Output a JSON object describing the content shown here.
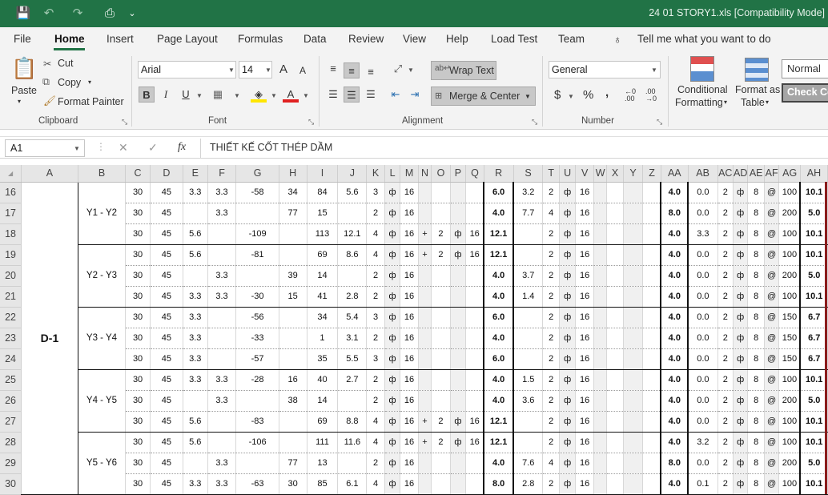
{
  "titlebar": {
    "save": "💾",
    "undo": "↶",
    "redo": "↷",
    "preview": "⎙",
    "customize": "⌄",
    "doc_title": "24 01 STORY1.xls  [Compatibility Mode]"
  },
  "tabs": [
    "File",
    "Home",
    "Insert",
    "Page Layout",
    "Formulas",
    "Data",
    "Review",
    "View",
    "Help",
    "Load Test",
    "Team"
  ],
  "tell_me": "Tell me what you want to do",
  "clipboard": {
    "paste": "Paste",
    "cut": "Cut",
    "copy": "Copy",
    "format_painter": "Format Painter",
    "group": "Clipboard"
  },
  "font": {
    "name": "Arial",
    "size": "14",
    "bold": "B",
    "italic": "I",
    "underline": "U",
    "grow": "A",
    "shrink": "A",
    "font_color": "A",
    "group": "Font"
  },
  "alignment": {
    "wrap": "Wrap Text",
    "merge": "Merge & Center",
    "group": "Alignment"
  },
  "number": {
    "format": "General",
    "currency": "$",
    "percent": "%",
    "comma": ",",
    "group": "Number"
  },
  "styles": {
    "conditional": "Conditional",
    "conditional2": "Formatting",
    "format_as": "Format as",
    "format_as2": "Table",
    "normal": "Normal",
    "check": "Check Ce"
  },
  "formula_bar": {
    "name_box": "A1",
    "cancel": "✕",
    "enter": "✓",
    "fx": "fx",
    "formula": "THIẾT KẾ CỐT THÉP DẦM"
  },
  "columns": [
    "A",
    "B",
    "C",
    "D",
    "E",
    "F",
    "G",
    "H",
    "I",
    "J",
    "K",
    "L",
    "M",
    "N",
    "O",
    "P",
    "Q",
    "R",
    "S",
    "T",
    "U",
    "V",
    "W",
    "X",
    "Y",
    "Z",
    "AA",
    "AB",
    "AC",
    "AD",
    "AE",
    "AF",
    "AG",
    "AH"
  ],
  "beam": "D-1",
  "groups": [
    "Y1 - Y2",
    "Y2 - Y3",
    "Y3 - Y4",
    "Y4 - Y5",
    "Y5 - Y6"
  ],
  "rows": [
    {
      "n": "16",
      "C": "30",
      "D": "45",
      "E": "3.3",
      "F": "3.3",
      "G": "-58",
      "H": "34",
      "I": "84",
      "J": "5.6",
      "K": "3",
      "L": "ф",
      "M": "16",
      "N": "",
      "O": "",
      "P": "",
      "Q": "",
      "R": "6.0",
      "S": "3.2",
      "T": "2",
      "U": "ф",
      "V": "16",
      "AA": "4.0",
      "AB": "0.0",
      "AC": "2",
      "AD": "ф",
      "AE": "8",
      "AF": "@",
      "AG": "100",
      "AH": "10.1"
    },
    {
      "n": "17",
      "C": "30",
      "D": "45",
      "E": "",
      "F": "3.3",
      "G": "",
      "H": "77",
      "I": "15",
      "J": "",
      "K": "2",
      "L": "ф",
      "M": "16",
      "N": "",
      "O": "",
      "P": "",
      "Q": "",
      "R": "4.0",
      "S": "7.7",
      "T": "4",
      "U": "ф",
      "V": "16",
      "AA": "8.0",
      "AB": "0.0",
      "AC": "2",
      "AD": "ф",
      "AE": "8",
      "AF": "@",
      "AG": "200",
      "AH": "5.0"
    },
    {
      "n": "18",
      "C": "30",
      "D": "45",
      "E": "5.6",
      "F": "",
      "G": "-109",
      "H": "",
      "I": "113",
      "J": "12.1",
      "K": "4",
      "L": "ф",
      "M": "16",
      "N": "+",
      "O": "2",
      "P": "ф",
      "Q": "16",
      "R": "12.1",
      "S": "",
      "T": "2",
      "U": "ф",
      "V": "16",
      "AA": "4.0",
      "AB": "3.3",
      "AC": "2",
      "AD": "ф",
      "AE": "8",
      "AF": "@",
      "AG": "100",
      "AH": "10.1"
    },
    {
      "n": "19",
      "C": "30",
      "D": "45",
      "E": "5.6",
      "F": "",
      "G": "-81",
      "H": "",
      "I": "69",
      "J": "8.6",
      "K": "4",
      "L": "ф",
      "M": "16",
      "N": "+",
      "O": "2",
      "P": "ф",
      "Q": "16",
      "R": "12.1",
      "S": "",
      "T": "2",
      "U": "ф",
      "V": "16",
      "AA": "4.0",
      "AB": "0.0",
      "AC": "2",
      "AD": "ф",
      "AE": "8",
      "AF": "@",
      "AG": "100",
      "AH": "10.1"
    },
    {
      "n": "20",
      "C": "30",
      "D": "45",
      "E": "",
      "F": "3.3",
      "G": "",
      "H": "39",
      "I": "14",
      "J": "",
      "K": "2",
      "L": "ф",
      "M": "16",
      "N": "",
      "O": "",
      "P": "",
      "Q": "",
      "R": "4.0",
      "S": "3.7",
      "T": "2",
      "U": "ф",
      "V": "16",
      "AA": "4.0",
      "AB": "0.0",
      "AC": "2",
      "AD": "ф",
      "AE": "8",
      "AF": "@",
      "AG": "200",
      "AH": "5.0"
    },
    {
      "n": "21",
      "C": "30",
      "D": "45",
      "E": "3.3",
      "F": "3.3",
      "G": "-30",
      "H": "15",
      "I": "41",
      "J": "2.8",
      "K": "2",
      "L": "ф",
      "M": "16",
      "N": "",
      "O": "",
      "P": "",
      "Q": "",
      "R": "4.0",
      "S": "1.4",
      "T": "2",
      "U": "ф",
      "V": "16",
      "AA": "4.0",
      "AB": "0.0",
      "AC": "2",
      "AD": "ф",
      "AE": "8",
      "AF": "@",
      "AG": "100",
      "AH": "10.1"
    },
    {
      "n": "22",
      "C": "30",
      "D": "45",
      "E": "3.3",
      "F": "",
      "G": "-56",
      "H": "",
      "I": "34",
      "J": "5.4",
      "K": "3",
      "L": "ф",
      "M": "16",
      "N": "",
      "O": "",
      "P": "",
      "Q": "",
      "R": "6.0",
      "S": "",
      "T": "2",
      "U": "ф",
      "V": "16",
      "AA": "4.0",
      "AB": "0.0",
      "AC": "2",
      "AD": "ф",
      "AE": "8",
      "AF": "@",
      "AG": "150",
      "AH": "6.7"
    },
    {
      "n": "23",
      "C": "30",
      "D": "45",
      "E": "3.3",
      "F": "",
      "G": "-33",
      "H": "",
      "I": "1",
      "J": "3.1",
      "K": "2",
      "L": "ф",
      "M": "16",
      "N": "",
      "O": "",
      "P": "",
      "Q": "",
      "R": "4.0",
      "S": "",
      "T": "2",
      "U": "ф",
      "V": "16",
      "AA": "4.0",
      "AB": "0.0",
      "AC": "2",
      "AD": "ф",
      "AE": "8",
      "AF": "@",
      "AG": "150",
      "AH": "6.7"
    },
    {
      "n": "24",
      "C": "30",
      "D": "45",
      "E": "3.3",
      "F": "",
      "G": "-57",
      "H": "",
      "I": "35",
      "J": "5.5",
      "K": "3",
      "L": "ф",
      "M": "16",
      "N": "",
      "O": "",
      "P": "",
      "Q": "",
      "R": "6.0",
      "S": "",
      "T": "2",
      "U": "ф",
      "V": "16",
      "AA": "4.0",
      "AB": "0.0",
      "AC": "2",
      "AD": "ф",
      "AE": "8",
      "AF": "@",
      "AG": "150",
      "AH": "6.7"
    },
    {
      "n": "25",
      "C": "30",
      "D": "45",
      "E": "3.3",
      "F": "3.3",
      "G": "-28",
      "H": "16",
      "I": "40",
      "J": "2.7",
      "K": "2",
      "L": "ф",
      "M": "16",
      "N": "",
      "O": "",
      "P": "",
      "Q": "",
      "R": "4.0",
      "S": "1.5",
      "T": "2",
      "U": "ф",
      "V": "16",
      "AA": "4.0",
      "AB": "0.0",
      "AC": "2",
      "AD": "ф",
      "AE": "8",
      "AF": "@",
      "AG": "100",
      "AH": "10.1"
    },
    {
      "n": "26",
      "C": "30",
      "D": "45",
      "E": "",
      "F": "3.3",
      "G": "",
      "H": "38",
      "I": "14",
      "J": "",
      "K": "2",
      "L": "ф",
      "M": "16",
      "N": "",
      "O": "",
      "P": "",
      "Q": "",
      "R": "4.0",
      "S": "3.6",
      "T": "2",
      "U": "ф",
      "V": "16",
      "AA": "4.0",
      "AB": "0.0",
      "AC": "2",
      "AD": "ф",
      "AE": "8",
      "AF": "@",
      "AG": "200",
      "AH": "5.0"
    },
    {
      "n": "27",
      "C": "30",
      "D": "45",
      "E": "5.6",
      "F": "",
      "G": "-83",
      "H": "",
      "I": "69",
      "J": "8.8",
      "K": "4",
      "L": "ф",
      "M": "16",
      "N": "+",
      "O": "2",
      "P": "ф",
      "Q": "16",
      "R": "12.1",
      "S": "",
      "T": "2",
      "U": "ф",
      "V": "16",
      "AA": "4.0",
      "AB": "0.0",
      "AC": "2",
      "AD": "ф",
      "AE": "8",
      "AF": "@",
      "AG": "100",
      "AH": "10.1"
    },
    {
      "n": "28",
      "C": "30",
      "D": "45",
      "E": "5.6",
      "F": "",
      "G": "-106",
      "H": "",
      "I": "111",
      "J": "11.6",
      "K": "4",
      "L": "ф",
      "M": "16",
      "N": "+",
      "O": "2",
      "P": "ф",
      "Q": "16",
      "R": "12.1",
      "S": "",
      "T": "2",
      "U": "ф",
      "V": "16",
      "AA": "4.0",
      "AB": "3.2",
      "AC": "2",
      "AD": "ф",
      "AE": "8",
      "AF": "@",
      "AG": "100",
      "AH": "10.1"
    },
    {
      "n": "29",
      "C": "30",
      "D": "45",
      "E": "",
      "F": "3.3",
      "G": "",
      "H": "77",
      "I": "13",
      "J": "",
      "K": "2",
      "L": "ф",
      "M": "16",
      "N": "",
      "O": "",
      "P": "",
      "Q": "",
      "R": "4.0",
      "S": "7.6",
      "T": "4",
      "U": "ф",
      "V": "16",
      "AA": "8.0",
      "AB": "0.0",
      "AC": "2",
      "AD": "ф",
      "AE": "8",
      "AF": "@",
      "AG": "200",
      "AH": "5.0"
    },
    {
      "n": "30",
      "C": "30",
      "D": "45",
      "E": "3.3",
      "F": "3.3",
      "G": "-63",
      "H": "30",
      "I": "85",
      "J": "6.1",
      "K": "4",
      "L": "ф",
      "M": "16",
      "N": "",
      "O": "",
      "P": "",
      "Q": "",
      "R": "8.0",
      "S": "2.8",
      "T": "2",
      "U": "ф",
      "V": "16",
      "AA": "4.0",
      "AB": "0.1",
      "AC": "2",
      "AD": "ф",
      "AE": "8",
      "AF": "@",
      "AG": "100",
      "AH": "10.1"
    }
  ]
}
